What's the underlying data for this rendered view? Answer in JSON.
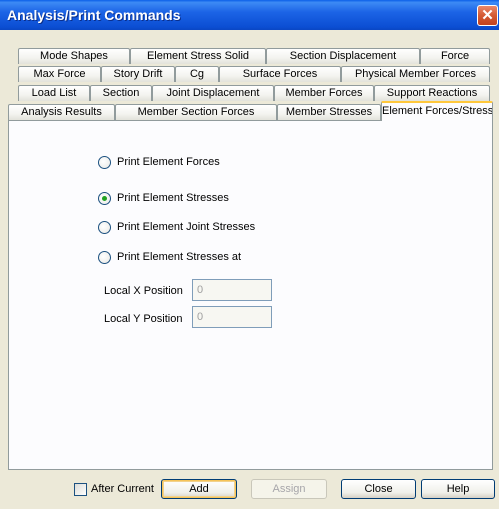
{
  "window": {
    "title": "Analysis/Print Commands",
    "close_glyph": "✕"
  },
  "tabs": {
    "row1": [
      "Mode Shapes",
      "Element Stress Solid",
      "Section Displacement",
      "Force"
    ],
    "row2": [
      "Max Force",
      "Story Drift",
      "Cg",
      "Surface Forces",
      "Physical Member Forces"
    ],
    "row3": [
      "Load List",
      "Section",
      "Joint Displacement",
      "Member Forces",
      "Support Reactions"
    ],
    "row4": [
      "Analysis Results",
      "Member Section Forces",
      "Member Stresses",
      "Element Forces/Stresses"
    ],
    "active": "Element Forces/Stresses"
  },
  "options": [
    {
      "label": "Print Element Forces",
      "checked": false
    },
    {
      "label": "Print Element Stresses",
      "checked": true
    },
    {
      "label": "Print Element Joint Stresses",
      "checked": false
    },
    {
      "label": "Print Element Stresses at",
      "checked": false
    }
  ],
  "position_fields": {
    "local_x": {
      "label": "Local X Position",
      "value": "0",
      "enabled": false
    },
    "local_y": {
      "label": "Local Y Position",
      "value": "0",
      "enabled": false
    }
  },
  "footer": {
    "after_current_label": "After Current",
    "after_current_checked": false,
    "add_label": "Add",
    "assign_label": "Assign",
    "close_label": "Close",
    "help_label": "Help"
  },
  "colors": {
    "title_bar": "#0B4ED3",
    "active_tab_accent": "#FFC83C",
    "dialog_bg": "#ECE9D8",
    "radio_checked": "#21A121"
  }
}
